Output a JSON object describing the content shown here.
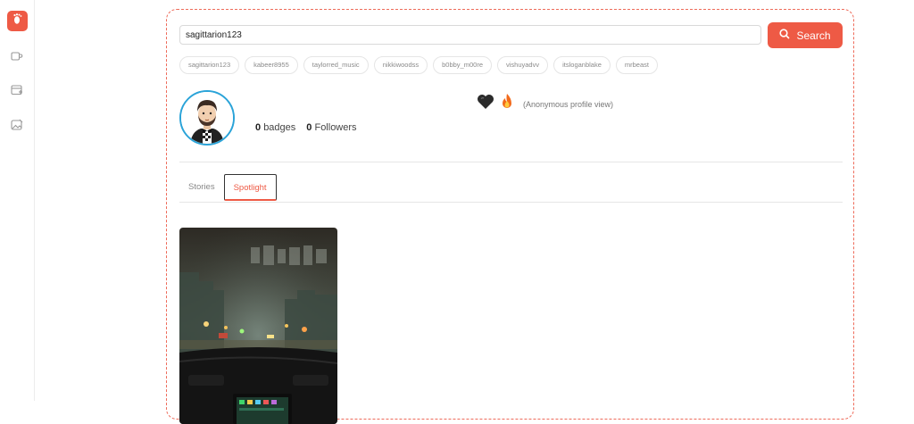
{
  "sidebar": {
    "logo_icon": "footprints-icon",
    "items": [
      {
        "icon": "cup-icon"
      },
      {
        "icon": "calendar-add-icon"
      },
      {
        "icon": "image-edit-icon"
      }
    ]
  },
  "search": {
    "value": "sagittarion123",
    "button_label": "Search"
  },
  "suggestions": [
    "sagittarion123",
    "kabeer8955",
    "taylorred_music",
    "nikkiwoodss",
    "b0bby_m00re",
    "vishuyadvv",
    "itsloganblake",
    "mrbeast"
  ],
  "profile": {
    "badges_count": "0",
    "badges_label": "badges",
    "followers_count": "0",
    "followers_label": "Followers",
    "anonymous_text": "(Anonymous profile view)"
  },
  "tabs": [
    {
      "label": "Stories",
      "active": false
    },
    {
      "label": "Spotlight",
      "active": true
    }
  ],
  "colors": {
    "accent": "#ee5a45",
    "avatar_ring": "#2aa3d8"
  }
}
